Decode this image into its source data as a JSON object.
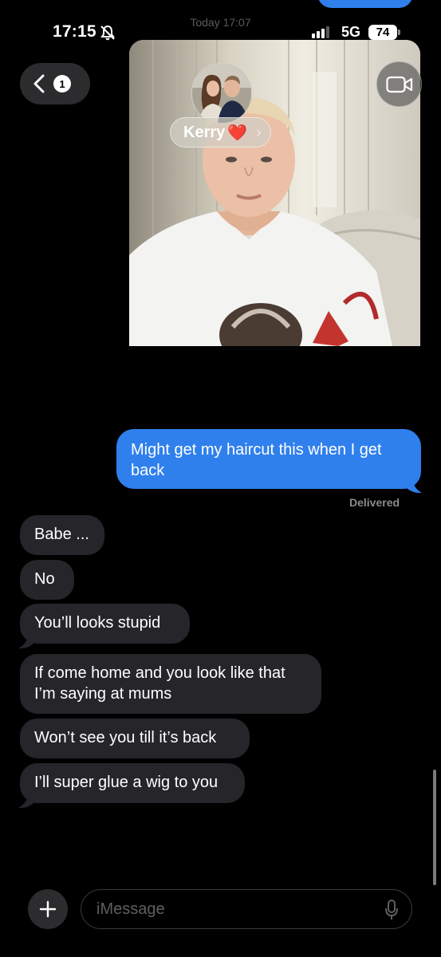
{
  "status_bar": {
    "time": "17:15",
    "network": "5G",
    "battery": "74"
  },
  "thread": {
    "date_header": "Today 17:07"
  },
  "header": {
    "back_count": "1",
    "contact_name": "Kerry",
    "contact_emoji": "❤️",
    "chevron": "›"
  },
  "messages": {
    "sent": [
      "Might get my haircut this when I get back"
    ],
    "delivered_label": "Delivered",
    "received": [
      "Babe ...",
      "No",
      "You’ll looks stupid",
      "If come home and you look like that I’m saying at mums",
      "Won’t see you till it’s back",
      "I’ll super glue a wig to you"
    ]
  },
  "composer": {
    "placeholder": "iMessage"
  },
  "colors": {
    "sent_bubble": "#2f80ed",
    "received_bubble": "#26252a",
    "background": "#000000"
  }
}
